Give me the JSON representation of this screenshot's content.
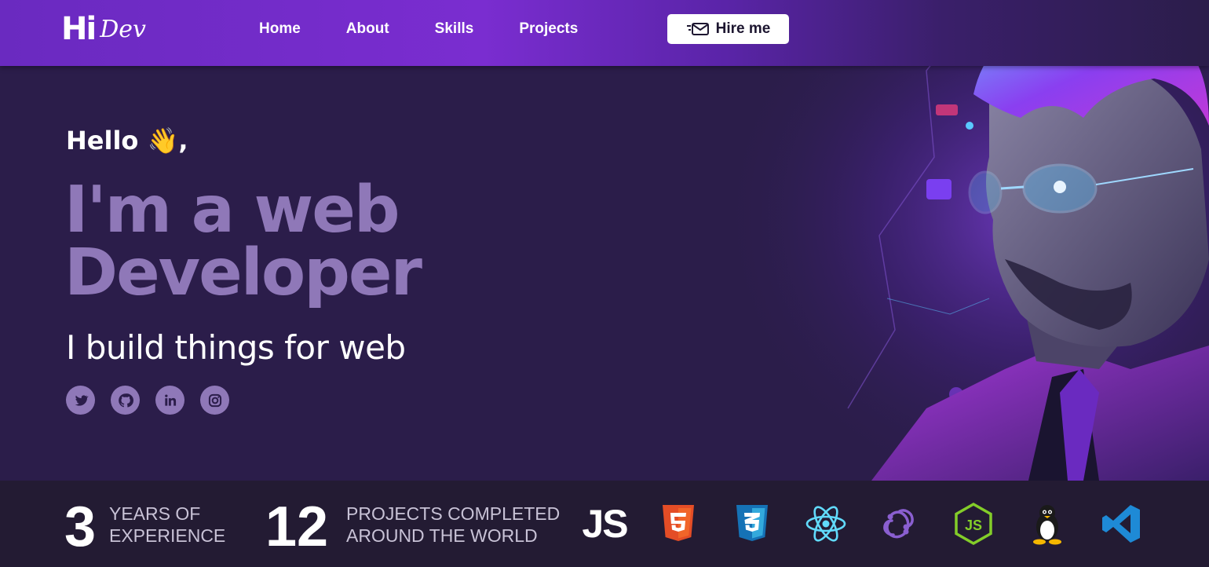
{
  "header": {
    "logo_mark": "Hi",
    "logo_dev": "Dev",
    "nav": [
      "Home",
      "About",
      "Skills",
      "Projects"
    ],
    "hire_label": "Hire me"
  },
  "hero": {
    "greeting": "Hello 👋,",
    "headline_line1": "I'm a web",
    "headline_line2": "Developer",
    "tagline": "I build things for web",
    "socials": [
      "twitter-icon",
      "github-icon",
      "linkedin-icon",
      "instagram-icon"
    ]
  },
  "stats": {
    "years_value": "3",
    "years_label_1": "YEARS OF",
    "years_label_2": "EXPERIENCE",
    "projects_value": "12",
    "projects_label_1": "PROJECTS COMPLETED",
    "projects_label_2": "AROUND THE WORLD",
    "js_label": "JS",
    "tech": [
      "javascript-icon",
      "html5-icon",
      "css3-icon",
      "react-icon",
      "redux-icon",
      "nodejs-icon",
      "linux-icon",
      "vscode-icon"
    ]
  },
  "colors": {
    "header_gradient_start": "#6a2ac0",
    "background": "#2b1d4a",
    "accent_muted": "#8f78b8",
    "stats_bar": "#231b33"
  }
}
